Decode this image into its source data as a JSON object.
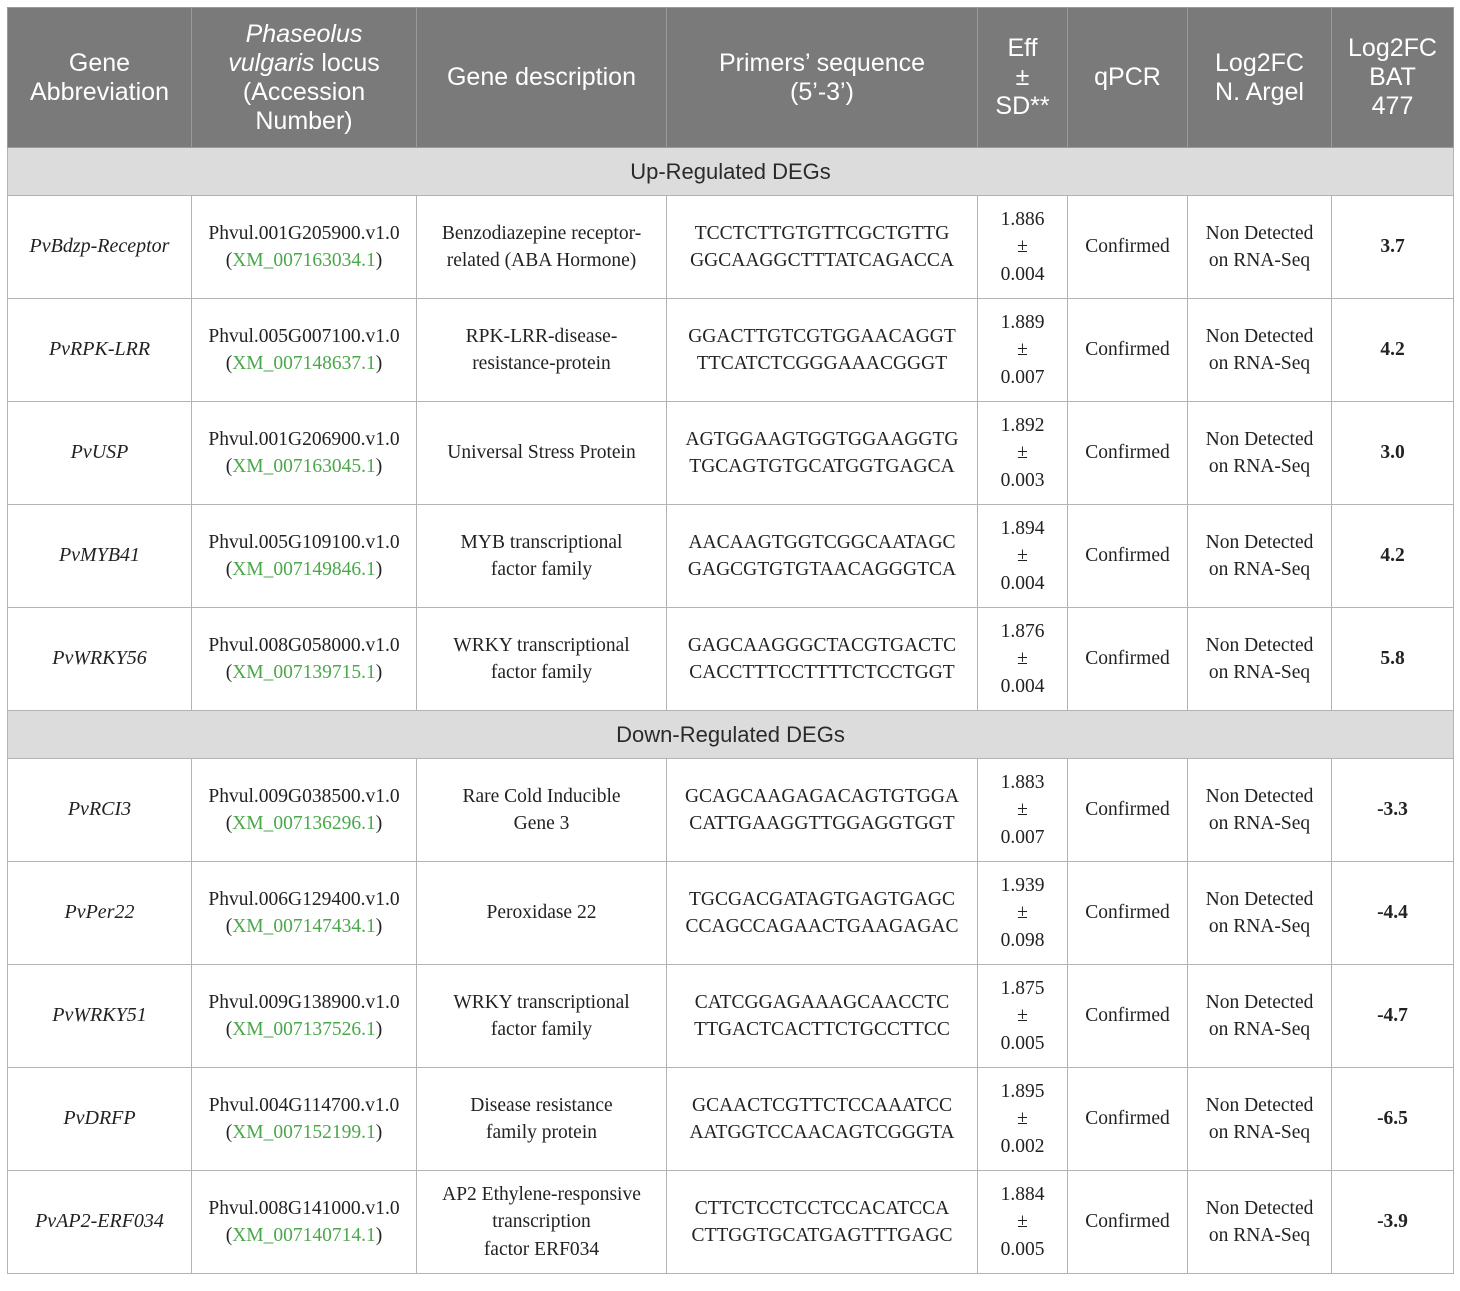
{
  "header": {
    "col1": [
      "Gene",
      "Abbreviation"
    ],
    "col2_italic": [
      "Phaseolus",
      "vulgaris"
    ],
    "col2_rest": " locus",
    "col2_lines": [
      "(Accession",
      "Number)"
    ],
    "col3": "Gene description",
    "col4": [
      "Primers’ sequence",
      "(5’-3’)"
    ],
    "col5": [
      "Eff",
      "±",
      "SD**"
    ],
    "col6": "qPCR",
    "col7": [
      "Log2FC",
      "N. Argel"
    ],
    "col8": [
      "Log2FC",
      "BAT",
      "477"
    ]
  },
  "sections": {
    "up": "Up-Regulated DEGs",
    "down": "Down-Regulated DEGs"
  },
  "up_rows": [
    {
      "gene": "PvBdzp-Receptor",
      "locus": "Phvul.001G205900.v1.0",
      "accession": "XM_007163034.1",
      "desc": [
        "Benzodiazepine receptor-",
        "related (ABA Hormone)"
      ],
      "primers": [
        "TCCTCTTGTGTTCGCTGTTG",
        "GGCAAGGCTTTATCAGACCA"
      ],
      "eff": "1.886",
      "pm": "±",
      "sd": "0.004",
      "qpcr": "Confirmed",
      "argel": [
        "Non Detected",
        "on RNA-Seq"
      ],
      "bat": "3.7"
    },
    {
      "gene": "PvRPK-LRR",
      "locus": "Phvul.005G007100.v1.0",
      "accession": "XM_007148637.1",
      "desc": [
        "RPK-LRR-disease-",
        "resistance-protein"
      ],
      "primers": [
        "GGACTTGTCGTGGAACAGGT",
        "TTCATCTCGGGAAACGGGT"
      ],
      "eff": "1.889",
      "pm": "±",
      "sd": "0.007",
      "qpcr": "Confirmed",
      "argel": [
        "Non Detected",
        "on RNA-Seq"
      ],
      "bat": "4.2"
    },
    {
      "gene": "PvUSP",
      "locus": "Phvul.001G206900.v1.0",
      "accession": "XM_007163045.1",
      "desc": [
        "Universal Stress Protein"
      ],
      "primers": [
        "AGTGGAAGTGGTGGAAGGTG",
        "TGCAGTGTGCATGGTGAGCA"
      ],
      "eff": "1.892",
      "pm": "±",
      "sd": "0.003",
      "qpcr": "Confirmed",
      "argel": [
        "Non Detected",
        "on RNA-Seq"
      ],
      "bat": "3.0"
    },
    {
      "gene": "PvMYB41",
      "locus": "Phvul.005G109100.v1.0",
      "accession": "XM_007149846.1",
      "desc": [
        "MYB transcriptional",
        "factor family"
      ],
      "primers": [
        "AACAAGTGGTCGGCAATAGC",
        "GAGCGTGTGTAACAGGGTCA"
      ],
      "eff": "1.894",
      "pm": "±",
      "sd": "0.004",
      "qpcr": "Confirmed",
      "argel": [
        "Non Detected",
        "on RNA-Seq"
      ],
      "bat": "4.2"
    },
    {
      "gene": "PvWRKY56",
      "locus": "Phvul.008G058000.v1.0",
      "accession": "XM_007139715.1",
      "desc": [
        "WRKY transcriptional",
        "factor family"
      ],
      "primers": [
        "GAGCAAGGGCTACGTGACTC",
        "CACCTTTCCTTTTCTCCTGGT"
      ],
      "eff": "1.876",
      "pm": "±",
      "sd": "0.004",
      "qpcr": "Confirmed",
      "argel": [
        "Non Detected",
        "on RNA-Seq"
      ],
      "bat": "5.8"
    }
  ],
  "down_rows": [
    {
      "gene": "PvRCI3",
      "locus": "Phvul.009G038500.v1.0",
      "accession": "XM_007136296.1",
      "desc": [
        "Rare Cold Inducible",
        "Gene 3"
      ],
      "primers": [
        "GCAGCAAGAGACAGTGTGGA",
        "CATTGAAGGTTGGAGGTGGT"
      ],
      "eff": "1.883",
      "pm": "±",
      "sd": "0.007",
      "qpcr": "Confirmed",
      "argel": [
        "Non Detected",
        "on RNA-Seq"
      ],
      "bat": "-3.3"
    },
    {
      "gene": "PvPer22",
      "locus": "Phvul.006G129400.v1.0",
      "accession": "XM_007147434.1",
      "desc": [
        "Peroxidase 22"
      ],
      "primers": [
        "TGCGACGATAGTGAGTGAGC",
        "CCAGCCAGAACTGAAGAGAC"
      ],
      "eff": "1.939",
      "pm": "±",
      "sd": "0.098",
      "qpcr": "Confirmed",
      "argel": [
        "Non Detected",
        "on RNA-Seq"
      ],
      "bat": "-4.4"
    },
    {
      "gene": "PvWRKY51",
      "locus": "Phvul.009G138900.v1.0",
      "accession": "XM_007137526.1",
      "desc": [
        "WRKY transcriptional",
        "factor family"
      ],
      "primers": [
        "CATCGGAGAAAGCAACCTC",
        "TTGACTCACTTCTGCCTTCC"
      ],
      "eff": "1.875",
      "pm": "±",
      "sd": "0.005",
      "qpcr": "Confirmed",
      "argel": [
        "Non Detected",
        "on RNA-Seq"
      ],
      "bat": "-4.7"
    },
    {
      "gene": "PvDRFP",
      "locus": "Phvul.004G114700.v1.0",
      "accession": "XM_007152199.1",
      "desc": [
        "Disease resistance",
        "family protein"
      ],
      "primers": [
        "GCAACTCGTTCTCCAAATCC",
        "AATGGTCCAACAGTCGGGTA"
      ],
      "eff": "1.895",
      "pm": "±",
      "sd": "0.002",
      "qpcr": "Confirmed",
      "argel": [
        "Non Detected",
        "on RNA-Seq"
      ],
      "bat": "-6.5"
    },
    {
      "gene": "PvAP2-ERF034",
      "locus": "Phvul.008G141000.v1.0",
      "accession": "XM_007140714.1",
      "desc": [
        "AP2 Ethylene-responsive",
        "transcription",
        "factor ERF034"
      ],
      "primers": [
        "CTTCTCCTCCTCCACATCCA",
        "CTTGGTGCATGAGTTTGAGC"
      ],
      "eff": "1.884",
      "pm": "±",
      "sd": "0.005",
      "qpcr": "Confirmed",
      "argel": [
        "Non Detected",
        "on RNA-Seq"
      ],
      "bat": "-3.9"
    }
  ]
}
